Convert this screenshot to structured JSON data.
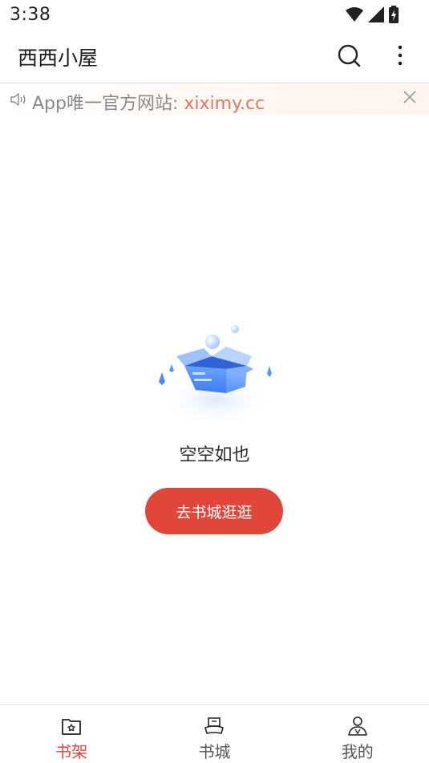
{
  "status_bar": {
    "time": "3:38"
  },
  "app_bar": {
    "title": "西西小屋",
    "search_icon": "search-icon",
    "more_icon": "more-vertical-icon"
  },
  "notice": {
    "prefix": "App唯一官方网站: ",
    "link": "xiximy.cc",
    "icon": "speaker-icon",
    "close_icon": "close-icon"
  },
  "empty_state": {
    "text": "空空如也",
    "button_label": "去书城逛逛"
  },
  "bottom_nav": {
    "active_color": "#e0473a",
    "items": [
      {
        "label": "书架",
        "icon": "bookshelf-icon",
        "active": true
      },
      {
        "label": "书城",
        "icon": "bookstore-icon",
        "active": false
      },
      {
        "label": "我的",
        "icon": "profile-icon",
        "active": false
      }
    ]
  }
}
